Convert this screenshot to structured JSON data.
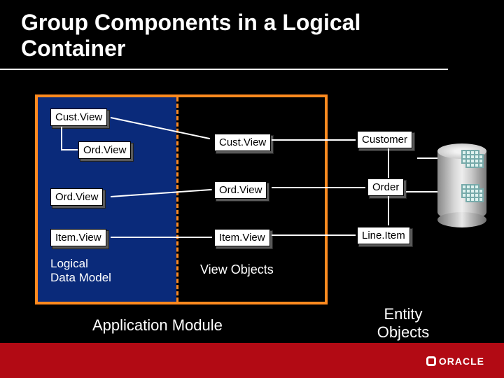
{
  "title": "Group Components in a Logical Container",
  "ldm": {
    "custView": "Cust.View",
    "ordView1": "Ord.View",
    "ordView2": "Ord.View",
    "itemView": "Item.View",
    "label": "Logical\nData Model"
  },
  "viewObjects": {
    "custView": "Cust.View",
    "ordView": "Ord.View",
    "itemView": "Item.View",
    "label": "View Objects"
  },
  "entityObjects": {
    "customer": "Customer",
    "order": "Order",
    "lineItem": "Line.Item",
    "label": "Entity\nObjects"
  },
  "appModuleLabel": "Application Module",
  "logo": "ORACLE"
}
